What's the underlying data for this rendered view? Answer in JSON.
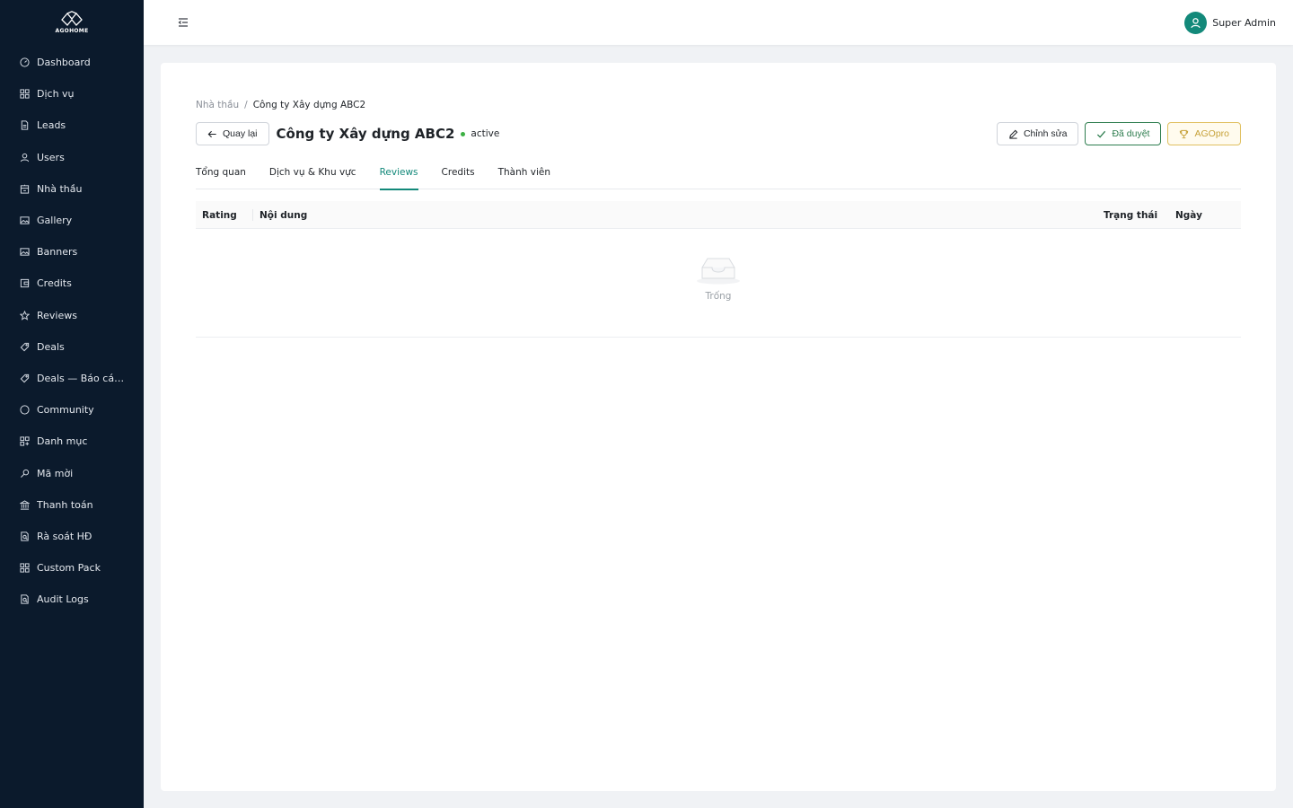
{
  "brand": {
    "logo_text": "AGOHOME"
  },
  "sidebar": {
    "items": [
      {
        "label": "Dashboard",
        "icon": "dashboard-icon"
      },
      {
        "label": "Dịch vụ",
        "icon": "grid-icon"
      },
      {
        "label": "Leads",
        "icon": "file-icon"
      },
      {
        "label": "Users",
        "icon": "user-icon"
      },
      {
        "label": "Nhà thầu",
        "icon": "building-icon"
      },
      {
        "label": "Gallery",
        "icon": "image-icon"
      },
      {
        "label": "Banners",
        "icon": "image-icon"
      },
      {
        "label": "Credits",
        "icon": "wallet-icon"
      },
      {
        "label": "Reviews",
        "icon": "star-icon"
      },
      {
        "label": "Deals",
        "icon": "tag-icon"
      },
      {
        "label": "Deals — Báo cáo ...",
        "icon": "tag-icon"
      },
      {
        "label": "Community",
        "icon": "chat-icon"
      },
      {
        "label": "Danh mục",
        "icon": "category-icon"
      },
      {
        "label": "Mã mời",
        "icon": "key-icon"
      },
      {
        "label": "Thanh toán",
        "icon": "bank-icon"
      },
      {
        "label": "Rà soát HĐ",
        "icon": "audit-icon"
      },
      {
        "label": "Custom Pack",
        "icon": "grid-icon"
      },
      {
        "label": "Audit Logs",
        "icon": "audit-icon"
      }
    ]
  },
  "header": {
    "user_name": "Super Admin"
  },
  "breadcrumb": {
    "parent": "Nhà thầu",
    "separator": "/",
    "current": "Công ty Xây dựng ABC2"
  },
  "page": {
    "back_label": "Quay lại",
    "title": "Công ty Xây dựng ABC2",
    "status": "active",
    "status_color": "#3cb043"
  },
  "actions": {
    "edit": "Chỉnh sửa",
    "approved": "Đã duyệt",
    "agopro": "AGOpro"
  },
  "tabs": [
    {
      "label": "Tổng quan",
      "active": false
    },
    {
      "label": "Dịch vụ & Khu vực",
      "active": false
    },
    {
      "label": "Reviews",
      "active": true
    },
    {
      "label": "Credits",
      "active": false
    },
    {
      "label": "Thành viên",
      "active": false
    }
  ],
  "table": {
    "columns": [
      "Rating",
      "Nội dung",
      "Trạng thái",
      "Ngày"
    ],
    "empty_text": "Trống"
  },
  "colors": {
    "sidebar_bg": "#0b1a2c",
    "accent": "#13897a",
    "approved": "#2e7d4f",
    "agopro": "#c7a23a"
  }
}
